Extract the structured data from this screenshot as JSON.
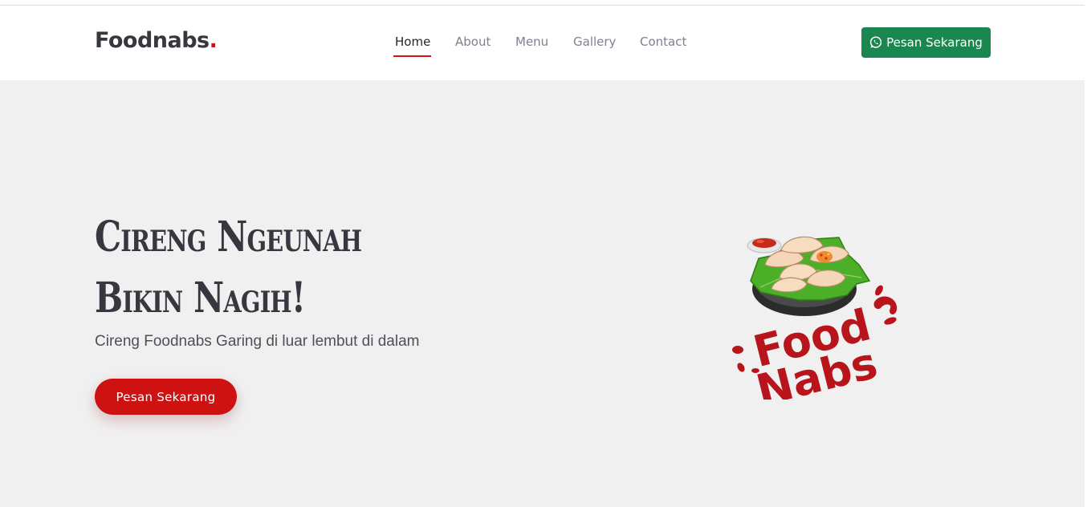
{
  "header": {
    "logo_text": "Foodnabs",
    "logo_dot": ".",
    "nav": [
      {
        "label": "Home",
        "active": true
      },
      {
        "label": "About",
        "active": false
      },
      {
        "label": "Menu",
        "active": false
      },
      {
        "label": "Gallery",
        "active": false
      },
      {
        "label": "Contact",
        "active": false
      }
    ],
    "order_button_label": "Pesan Sekarang",
    "order_button_icon": "whatsapp-icon"
  },
  "hero": {
    "title_line1": "Cireng Ngeunah",
    "title_line2": "Bikin Nagih!",
    "subtitle": "Cireng Foodnabs Garing di luar lembut di dalam",
    "cta_label": "Pesan Sekarang",
    "logo_image": {
      "line1": "Food",
      "line2": "Nabs"
    }
  },
  "colors": {
    "brand_red": "#ce1212",
    "whatsapp_green": "#19874f",
    "text_dark": "#37373f",
    "nav_text": "#7f7f90",
    "hero_bg": "#f0f0f0"
  }
}
